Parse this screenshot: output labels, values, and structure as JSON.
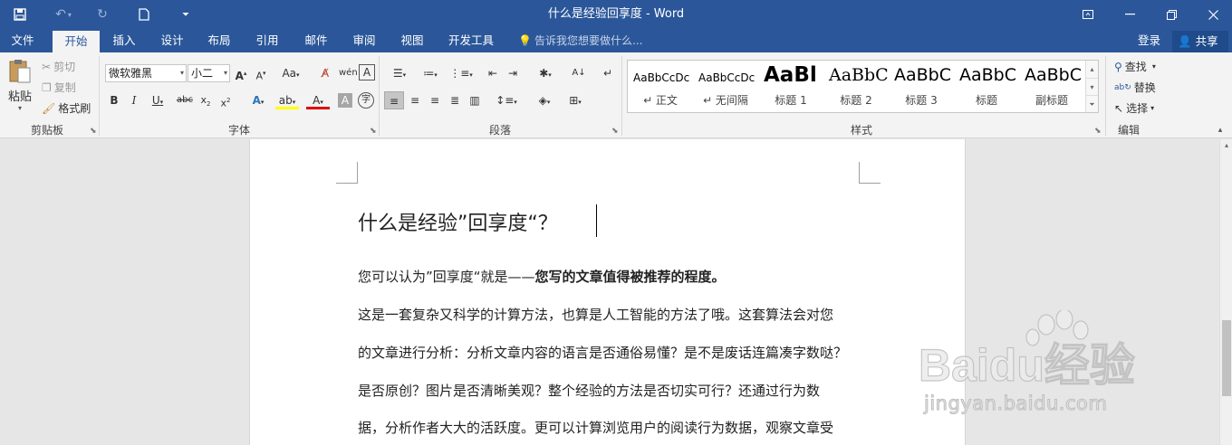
{
  "window": {
    "title": "什么是经验回享度 - Word"
  },
  "tabs": [
    "文件",
    "开始",
    "插入",
    "设计",
    "布局",
    "引用",
    "邮件",
    "审阅",
    "视图",
    "开发工具"
  ],
  "tell_me": "告诉我您想要做什么...",
  "account": {
    "login": "登录",
    "share": "共享"
  },
  "ribbon": {
    "clipboard": {
      "label": "剪贴板",
      "paste": "粘贴",
      "cut": "剪切",
      "copy": "复制",
      "format_painter": "格式刷"
    },
    "font": {
      "label": "字体",
      "font_name": "微软雅黑",
      "font_size": "小二"
    },
    "paragraph": {
      "label": "段落"
    },
    "styles": {
      "label": "样式",
      "items": [
        {
          "preview": "AaBbCcDc",
          "name": "↵ 正文"
        },
        {
          "preview": "AaBbCcDc",
          "name": "↵ 无间隔"
        },
        {
          "preview": "AaBl",
          "name": "标题 1"
        },
        {
          "preview": "AaBbC",
          "name": "标题 2"
        },
        {
          "preview": "AaBbC",
          "name": "标题 3"
        },
        {
          "preview": "AaBbC",
          "name": "标题"
        },
        {
          "preview": "AaBbC",
          "name": "副标题"
        }
      ]
    },
    "editing": {
      "label": "编辑",
      "find": "查找",
      "replace": "替换",
      "select": "选择"
    }
  },
  "document": {
    "title": "什么是经验”回享度“？",
    "line1_normal": "您可以认为”回享度“就是——",
    "line1_bold": "您写的文章值得被推荐的程度。",
    "lines": [
      "这是一套复杂又科学的计算方法，也算是人工智能的方法了哦。这套算法会对您",
      "的文章进行分析：分析文章内容的语言是否通俗易懂？是不是废话连篇凑字数哒？",
      "是否原创？图片是否清晰美观？整个经验的方法是否切实可行？还通过行为数",
      "据，分析作者大大的活跃度。更可以计算浏览用户的阅读行为数据，观察文章受"
    ]
  },
  "watermark": {
    "brand_text": "Baidu经验",
    "url": "jingyan.baidu.com"
  },
  "colors": {
    "titlebar": "#2b579a",
    "ribbon_bg": "#f3f3f3",
    "doc_bg": "#e6e6e6"
  }
}
